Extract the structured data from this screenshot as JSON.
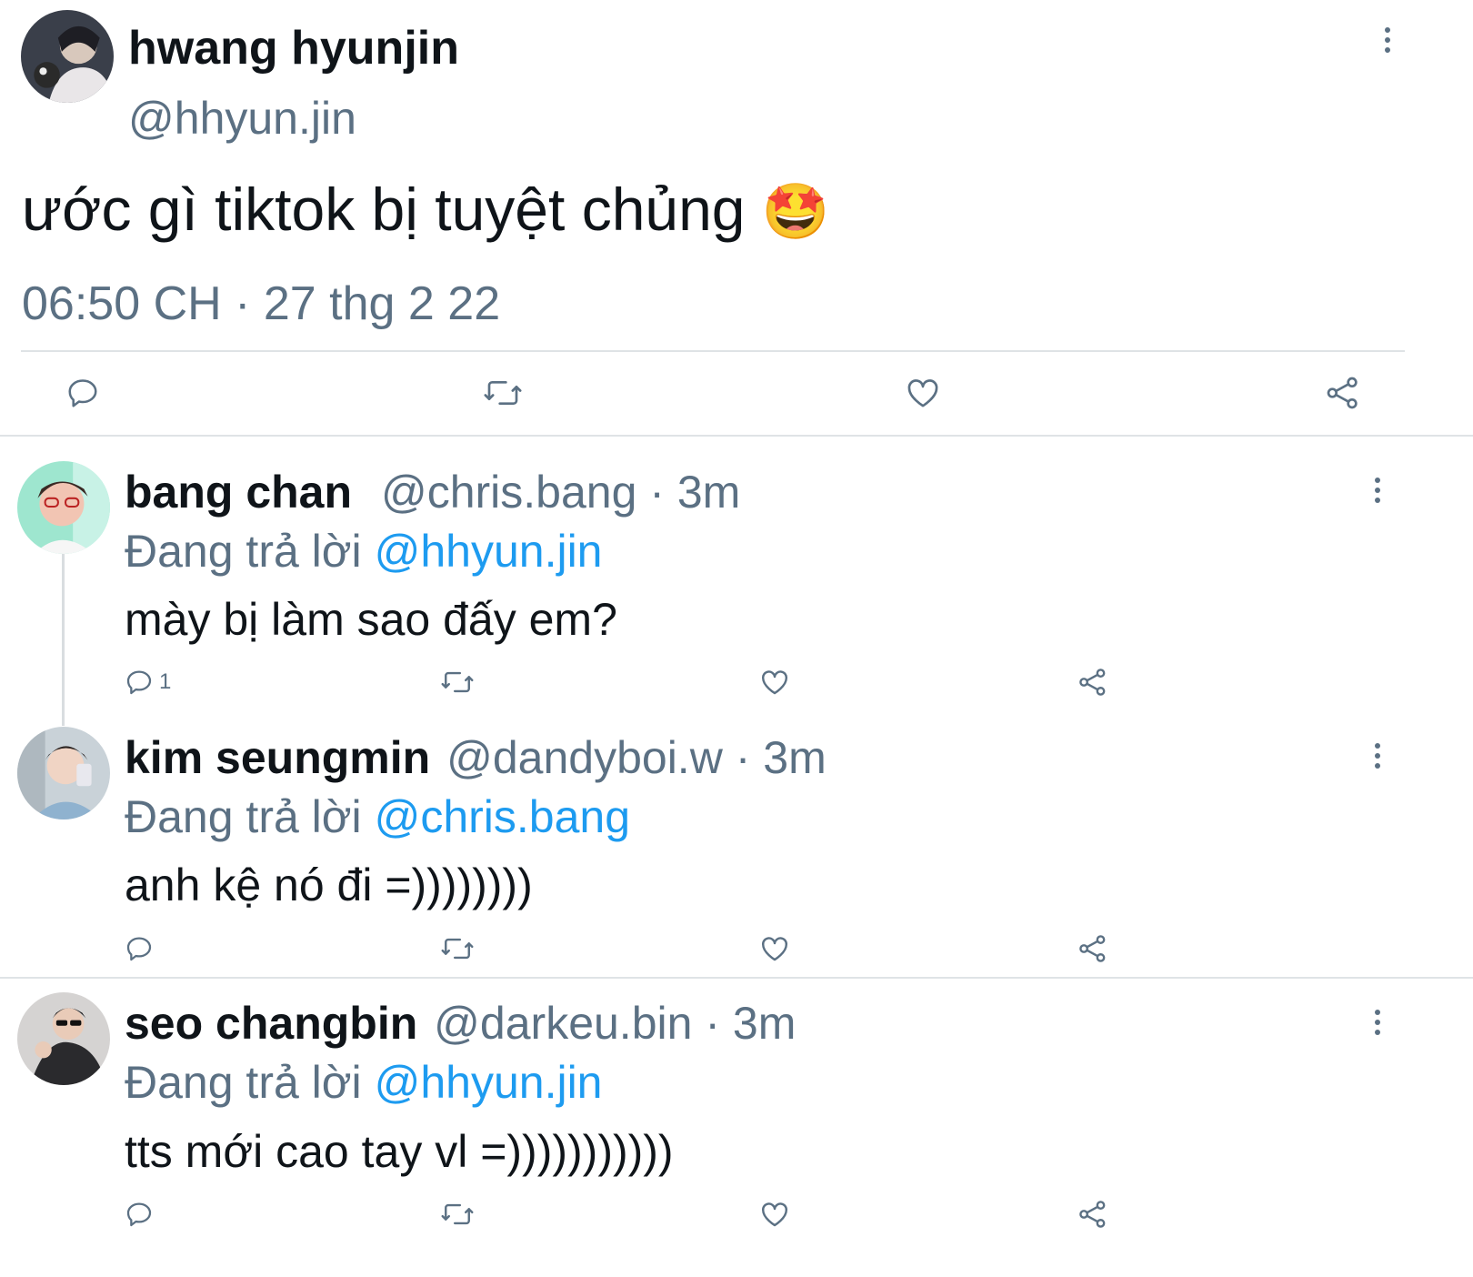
{
  "main_tweet": {
    "author_name": "hwang hyunjin",
    "handle": "@hhyun.jin",
    "text": "ước gì tiktok bị tuyệt chủng",
    "emoji": "🤩",
    "timestamp": "06:50 CH · 27 thg 2 22",
    "actions": [
      "reply-icon",
      "retweet-icon",
      "like-icon",
      "share-icon"
    ]
  },
  "replies": [
    {
      "author_name": "bang chan",
      "handle": "@chris.bang",
      "time": "· 3m",
      "replying_prefix": "Đang trả lời",
      "replying_to": "@hhyun.jin",
      "text": "mày bị làm sao đấy em?",
      "reply_count": "1"
    },
    {
      "author_name": "kim seungmin",
      "handle": "@dandyboi.w",
      "time": "· 3m",
      "replying_prefix": "Đang trả lời",
      "replying_to": "@chris.bang",
      "text": "anh kệ nó đi =))))))))",
      "reply_count": ""
    },
    {
      "author_name": "seo changbin",
      "handle": "@darkeu.bin",
      "time": "· 3m",
      "replying_prefix": "Đang trả lời",
      "replying_to": "@hhyun.jin",
      "text": "tts mới cao tay vl =)))))))))))",
      "reply_count": ""
    }
  ],
  "colors": {
    "text": "#0f1419",
    "muted": "#5b7083",
    "link": "#1d9bf0",
    "divider": "#dfe3e6"
  }
}
